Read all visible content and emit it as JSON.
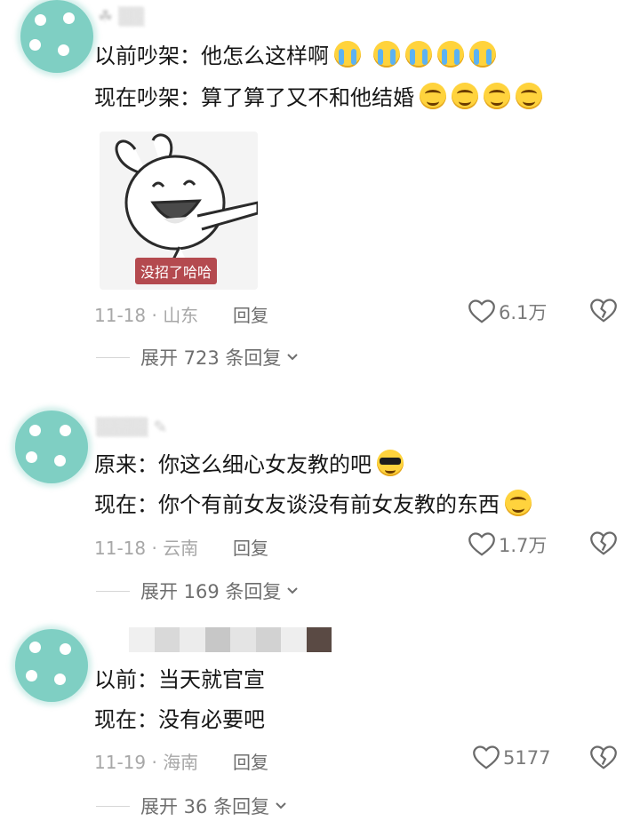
{
  "comments": [
    {
      "line1": "以前吵架：他怎么这样啊",
      "line1_emojis": [
        "cry",
        "cry",
        "cry",
        "cry",
        "cry"
      ],
      "line2": "现在吵架：算了算了又不和他结婚",
      "line2_emojis": [
        "smile",
        "smile",
        "smile",
        "smile"
      ],
      "sticker_text": "没招了哈哈",
      "date_location": "11-18 · 山东",
      "reply_label": "回复",
      "likes": "6.1万",
      "expand_label": "展开 723 条回复"
    },
    {
      "line1": "原来：你这么细心女友教的吧",
      "line1_emojis": [
        "cool"
      ],
      "line2": "现在：你个有前女友谈没有前女友教的东西",
      "line2_emojis": [
        "smile"
      ],
      "date_location": "11-18 · 云南",
      "reply_label": "回复",
      "likes": "1.7万",
      "expand_label": "展开 169 条回复"
    },
    {
      "line1": "以前：当天就官宣",
      "line2": "现在：没有必要吧",
      "date_location": "11-19 · 海南",
      "reply_label": "回复",
      "likes": "5177",
      "expand_label": "展开 36 条回复"
    }
  ],
  "colors": {
    "avatar": "#7fcfc3",
    "text": "#161616",
    "meta": "#a7a7a7",
    "sticker_label_bg": "#b44a4f"
  },
  "icons": {
    "like": "heart-outline-icon",
    "dislike": "broken-heart-icon",
    "expand": "chevron-down-icon"
  }
}
